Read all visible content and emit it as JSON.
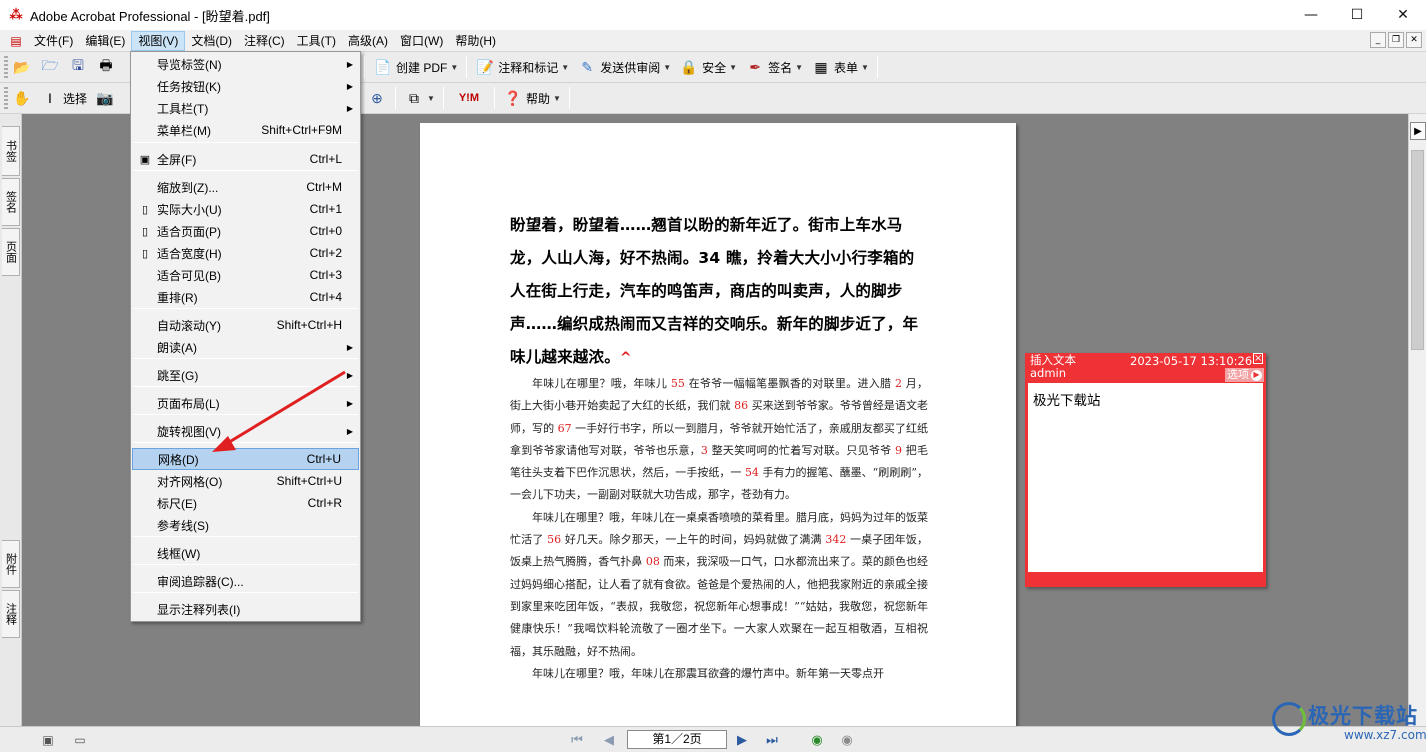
{
  "window": {
    "title": "Adobe Acrobat Professional - [盼望着.pdf]",
    "minimize": "—",
    "maximize": "☐",
    "close": "✕"
  },
  "menubar": {
    "items": [
      "文件(F)",
      "编辑(E)",
      "视图(V)",
      "文档(D)",
      "注释(C)",
      "工具(T)",
      "高级(A)",
      "窗口(W)",
      "帮助(H)"
    ],
    "active_index": 2
  },
  "toolbar1": {
    "create_pdf": "创建 PDF",
    "comment_markup": "注释和标记",
    "send_review": "发送供审阅",
    "security": "安全",
    "sign": "签名",
    "forms": "表单"
  },
  "toolbar2": {
    "select": "选择",
    "help": "帮助"
  },
  "left_tabs": [
    "书签",
    "签名",
    "页面",
    "附件",
    "注释"
  ],
  "view_menu": {
    "items": [
      {
        "label": "导览标签(N)",
        "shortcut": "",
        "submenu": true,
        "icon": ""
      },
      {
        "label": "任务按钮(K)",
        "shortcut": "",
        "submenu": true,
        "icon": ""
      },
      {
        "label": "工具栏(T)",
        "shortcut": "",
        "submenu": true,
        "icon": ""
      },
      {
        "label": "菜单栏(M)",
        "shortcut": "Shift+Ctrl+F9M",
        "submenu": false,
        "icon": ""
      },
      {
        "label": "全屏(F)",
        "shortcut": "Ctrl+L",
        "submenu": false,
        "icon": "fullscreen-icon"
      },
      {
        "label": "缩放到(Z)...",
        "shortcut": "Ctrl+M",
        "submenu": false,
        "icon": ""
      },
      {
        "label": "实际大小(U)",
        "shortcut": "Ctrl+1",
        "submenu": false,
        "icon": "actual-size-icon"
      },
      {
        "label": "适合页面(P)",
        "shortcut": "Ctrl+0",
        "submenu": false,
        "icon": "fit-page-icon"
      },
      {
        "label": "适合宽度(H)",
        "shortcut": "Ctrl+2",
        "submenu": false,
        "icon": "fit-width-icon"
      },
      {
        "label": "适合可见(B)",
        "shortcut": "Ctrl+3",
        "submenu": false,
        "icon": ""
      },
      {
        "label": "重排(R)",
        "shortcut": "Ctrl+4",
        "submenu": false,
        "icon": ""
      },
      {
        "label": "自动滚动(Y)",
        "shortcut": "Shift+Ctrl+H",
        "submenu": false,
        "icon": ""
      },
      {
        "label": "朗读(A)",
        "shortcut": "",
        "submenu": true,
        "icon": ""
      },
      {
        "label": "跳至(G)",
        "shortcut": "",
        "submenu": true,
        "icon": ""
      },
      {
        "label": "页面布局(L)",
        "shortcut": "",
        "submenu": true,
        "icon": ""
      },
      {
        "label": "旋转视图(V)",
        "shortcut": "",
        "submenu": true,
        "icon": ""
      },
      {
        "label": "网格(D)",
        "shortcut": "Ctrl+U",
        "submenu": false,
        "icon": ""
      },
      {
        "label": "对齐网格(O)",
        "shortcut": "Shift+Ctrl+U",
        "submenu": false,
        "icon": ""
      },
      {
        "label": "标尺(E)",
        "shortcut": "Ctrl+R",
        "submenu": false,
        "icon": ""
      },
      {
        "label": "参考线(S)",
        "shortcut": "",
        "submenu": false,
        "icon": ""
      },
      {
        "label": "线框(W)",
        "shortcut": "",
        "submenu": false,
        "icon": ""
      },
      {
        "label": "审阅追踪器(C)...",
        "shortcut": "",
        "submenu": false,
        "icon": ""
      },
      {
        "label": "显示注释列表(I)",
        "shortcut": "",
        "submenu": false,
        "icon": ""
      }
    ],
    "highlighted_index": 16
  },
  "document": {
    "heading": "盼望着，盼望着……翘首以盼的新年近了。街市上车水马龙，人山人海，好不热闹。34 瞧，拎着大大小小行李箱的人在街上行走，汽车的鸣笛声，商店的叫卖声，人的脚步声……编织成热闹而又吉祥的交响乐。新年的脚步近了，年味儿越来越浓。",
    "caret": "^",
    "paragraphs": [
      [
        {
          "t": "年味儿在哪里？哦，年味儿 "
        },
        {
          "n": "55"
        },
        {
          "t": " 在爷爷一幅幅笔墨飘香的对联里。进入腊 "
        },
        {
          "n": "2"
        },
        {
          "t": " 月，街上大街小巷开始卖起了大红的长纸，我们就 "
        },
        {
          "n": "86"
        },
        {
          "t": " 买来送到爷爷家。爷爷曾经是语文老师，写的 "
        },
        {
          "n": "67"
        },
        {
          "t": " 一手好行书字，所以一到腊月，爷爷就开始忙活了，亲戚朋友都买了红纸拿到爷爷家请他写对联，爷爷也乐意，"
        },
        {
          "n": "3"
        },
        {
          "t": " 整天笑呵呵的忙着写对联。只见爷爷 "
        },
        {
          "n": "9"
        },
        {
          "t": " 把毛笔往头支着下巴作沉思状，然后，一手按纸，一 "
        },
        {
          "n": "54"
        },
        {
          "t": " 手有力的握笔、蘸墨、“刷刷刷”，一会儿下功夫，一副副对联就大功告成，那字，苍劲有力。"
        }
      ],
      [
        {
          "t": "年味儿在哪里？哦，年味儿在一桌桌香喷喷的菜肴里。腊月底，妈妈为过年的饭菜忙活了 "
        },
        {
          "n": "56"
        },
        {
          "t": " 好几天。除夕那天，一上午的时间，妈妈就做了满满 "
        },
        {
          "n": "342"
        },
        {
          "t": " 一桌子团年饭，饭桌上热气腾腾，香气扑鼻 "
        },
        {
          "n": "08"
        },
        {
          "t": " 而来，我深吸一口气，口水都流出来了。菜的颜色也经过妈妈细心搭配，让人看了就有食欲。爸爸是个爱热闹的人，他把我家附近的亲戚全接到家里来吃团年饭，“表叔，我敬您，祝您新年心想事成！”“姑姑，我敬您，祝您新年健康快乐！”我喝饮料轮流敬了一圈才坐下。一大家人欢聚在一起互相敬酒，互相祝福，其乐融融，好不热闹。"
        }
      ],
      [
        {
          "t": "年味儿在哪里？哦，年味儿在那震耳欲聋的爆竹声中。新年第一天零点开"
        }
      ]
    ]
  },
  "note": {
    "type": "插入文本",
    "author": "admin",
    "datetime": "2023-05-17 13:10:26",
    "options": "选项",
    "content": "极光下载站"
  },
  "statusbar": {
    "page": "第1／2页"
  },
  "watermark": {
    "name": "极光下载站",
    "url": "www.xz7.com"
  }
}
